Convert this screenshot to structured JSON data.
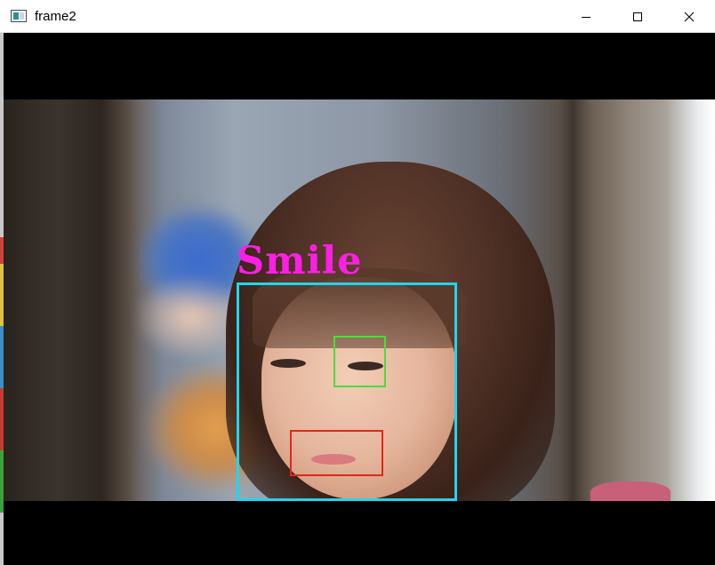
{
  "window": {
    "title": "frame2",
    "icon": "app-icon",
    "controls": [
      "minimize-icon",
      "maximize-icon",
      "close-icon"
    ]
  },
  "detection": {
    "label": "Smile",
    "label_color": "#ff1ee6",
    "face_box_color": "#1fd6f0",
    "eye_box_color": "#4cdc3c",
    "mouth_box_color": "#e3261c"
  }
}
